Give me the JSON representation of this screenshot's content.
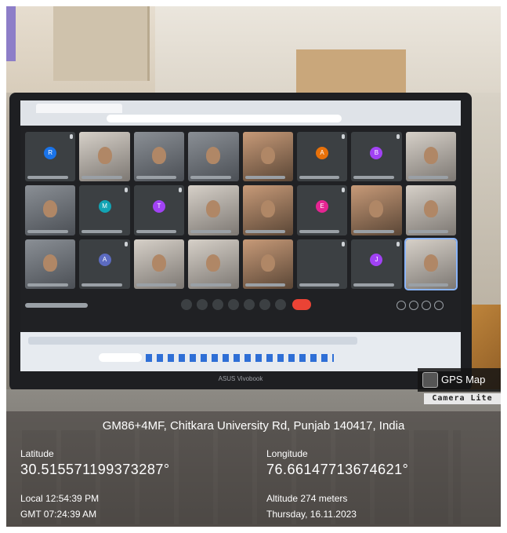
{
  "brand": {
    "logo_title": "GPS Map",
    "logo_subtitle": "Camera Lite"
  },
  "laptop": {
    "brand_text": "ASUS Vivobook"
  },
  "meeting_grid": {
    "tile_count": 24,
    "avatar_letters": [
      "R",
      "M",
      "T",
      "A",
      "E",
      "A",
      "B",
      "J"
    ]
  },
  "location": {
    "address": "GM86+4MF, Chitkara University Rd, Punjab 140417, India",
    "latitude_label": "Latitude",
    "latitude_value": "30.515571199373287°",
    "longitude_label": "Longitude",
    "longitude_value": "76.66147713674621°",
    "local_time": "Local 12:54:39 PM",
    "gmt_time": "GMT 07:24:39 AM",
    "altitude": "Altitude 274 meters",
    "date": "Thursday, 16.11.2023"
  },
  "colors": {
    "avatar_blue": "#1a73e8",
    "avatar_teal": "#12a4b4",
    "avatar_purple": "#a142f4",
    "avatar_orange": "#e8710a",
    "avatar_pink": "#e52592",
    "avatar_indigo": "#5c6bc0",
    "end_call_red": "#ea4335"
  }
}
